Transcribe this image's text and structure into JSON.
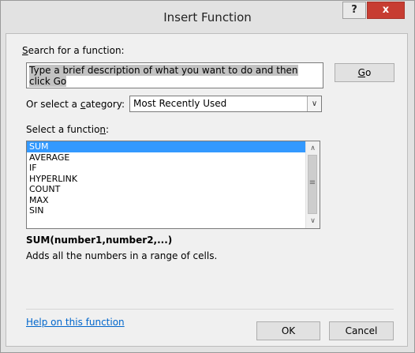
{
  "window": {
    "title": "Insert Function",
    "help_button": "?",
    "close_button": "x"
  },
  "search": {
    "label_mnemonic": "S",
    "label_rest": "earch for a function:",
    "value": "Type a brief description of what you want to do and then click Go",
    "go_mnemonic": "G",
    "go_rest": "o"
  },
  "category": {
    "label_before": "Or select a ",
    "label_mnemonic": "c",
    "label_after": "ategory:",
    "selected": "Most Recently Used"
  },
  "function_list": {
    "label_before": "Select a functio",
    "label_mnemonic": "n",
    "label_after": ":",
    "items": [
      "SUM",
      "AVERAGE",
      "IF",
      "HYPERLINK",
      "COUNT",
      "MAX",
      "SIN"
    ],
    "selected_index": 0
  },
  "details": {
    "signature": "SUM(number1,number2,...)",
    "description": "Adds all the numbers in a range of cells."
  },
  "footer": {
    "help_link": "Help on this function",
    "ok": "OK",
    "cancel": "Cancel"
  }
}
